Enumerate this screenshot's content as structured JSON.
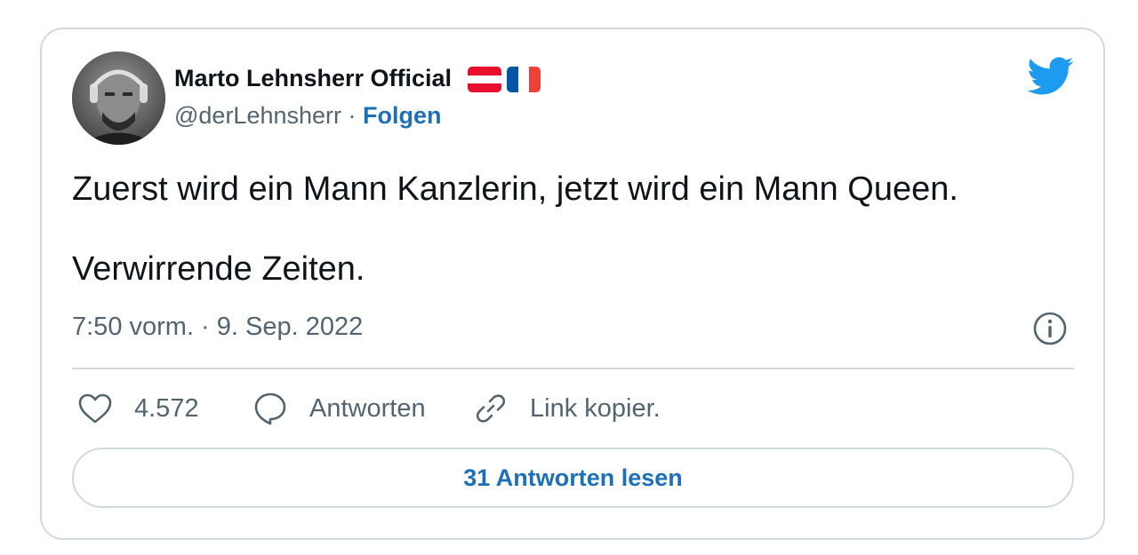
{
  "author": {
    "name": "Marto Lehnsherr Official",
    "handle": "@derLehnsherr",
    "separator": "·",
    "follow_label": "Folgen"
  },
  "tweet": {
    "line1": "Zuerst wird ein Mann Kanzlerin, jetzt wird ein Mann Queen.",
    "line2": "Verwirrende Zeiten.",
    "timestamp": "7:50 vorm. · 9. Sep. 2022"
  },
  "actions": {
    "like_count": "4.572",
    "reply_label": "Antworten",
    "copy_label": "Link kopier."
  },
  "read_replies_label": "31 Antworten lesen",
  "icons": {
    "flags": [
      "austria-flag-icon",
      "france-flag-icon"
    ],
    "brand": "twitter-bird-icon",
    "info": "info-icon",
    "like": "heart-icon",
    "reply": "speech-bubble-icon",
    "copy": "link-icon"
  },
  "colors": {
    "link_blue": "#1d70b8",
    "twitter_blue": "#1d9bf0",
    "secondary_text": "#536471",
    "border": "#cfd9de",
    "austria_red": "#e8112d",
    "france_blue": "#0055a4",
    "france_red": "#ef4135"
  }
}
